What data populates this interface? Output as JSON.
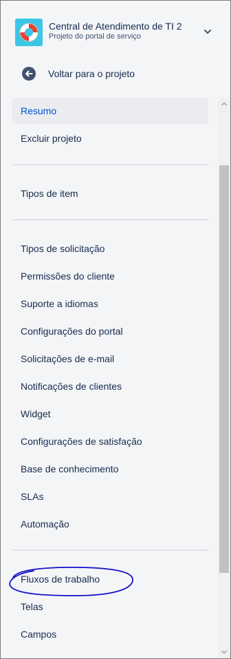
{
  "header": {
    "project_name": "Central de Atendimento de TI 2",
    "project_type": "Projeto do portal de serviço",
    "avatar_icon": "lifebuoy-icon",
    "menu_icon": "chevron-down-icon"
  },
  "back": {
    "label": "Voltar para o projeto",
    "icon": "arrow-left-circle-icon"
  },
  "nav": {
    "group1": [
      "Resumo",
      "Excluir projeto"
    ],
    "group2": [
      "Tipos de item"
    ],
    "group3": [
      "Tipos de solicitação",
      "Permissões do cliente",
      "Suporte a idiomas",
      "Configurações do portal",
      "Solicitações de e-mail",
      "Notificações de clientes",
      "Widget",
      "Configurações de satisfação",
      "Base de conhecimento",
      "SLAs",
      "Automação"
    ],
    "group4": [
      "Fluxos de trabalho",
      "Telas",
      "Campos"
    ],
    "selected": "Resumo"
  },
  "colors": {
    "sidebar_bg": "#f4f5f7",
    "selected_text": "#0052cc",
    "avatar_bg": "#3cc6e6",
    "annotation": "#1010c8"
  }
}
